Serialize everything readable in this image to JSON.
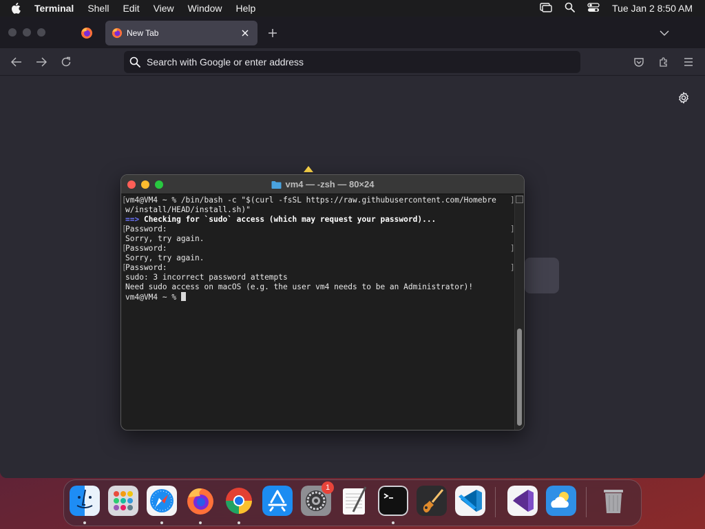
{
  "menubar": {
    "app_name": "Terminal",
    "items": [
      "Shell",
      "Edit",
      "View",
      "Window",
      "Help"
    ],
    "clock": "Tue Jan 2  8:50 AM"
  },
  "browser": {
    "tab_title": "New Tab",
    "url_placeholder": "Search with Google or enter address"
  },
  "terminal": {
    "title": "vm4 — -zsh — 80×24",
    "lines": [
      {
        "text": "vm4@VM4 ~ % /bin/bash -c \"$(curl -fsSL https://raw.githubusercontent.com/Homebre",
        "left_bracket": true,
        "right_bracket": true
      },
      {
        "text": "w/install/HEAD/install.sh)\""
      },
      {
        "prefix": "==>",
        "text": " Checking for `sudo` access (which may request your password)..."
      },
      {
        "text": "Password:",
        "left_bracket": true,
        "right_bracket": true
      },
      {
        "text": "Sorry, try again."
      },
      {
        "text": "Password:",
        "left_bracket": true,
        "right_bracket": true
      },
      {
        "text": "Sorry, try again."
      },
      {
        "text": "Password:",
        "left_bracket": true,
        "right_bracket": true
      },
      {
        "text": "sudo: 3 incorrect password attempts"
      },
      {
        "text": "Need sudo access on macOS (e.g. the user vm4 needs to be an Administrator)!"
      },
      {
        "text": "vm4@VM4 ~ % ",
        "cursor": true
      }
    ],
    "scroll_position": 0.55
  },
  "dock": {
    "apps": [
      {
        "name": "finder",
        "running": true
      },
      {
        "name": "launchpad",
        "running": false
      },
      {
        "name": "safari",
        "running": true
      },
      {
        "name": "firefox",
        "running": true
      },
      {
        "name": "chrome",
        "running": true
      },
      {
        "name": "app-store",
        "running": false
      },
      {
        "name": "system-settings",
        "running": false,
        "badge": "1"
      },
      {
        "name": "textedit",
        "running": false
      },
      {
        "name": "terminal",
        "running": true
      },
      {
        "name": "garageband",
        "running": false
      },
      {
        "name": "vscode",
        "running": false
      },
      {
        "name": "visual-studio",
        "running": false
      },
      {
        "name": "weather",
        "running": false
      },
      {
        "name": "trash",
        "running": false
      }
    ]
  },
  "colors": {
    "terminal_prompt_arrow": "#6b74ff",
    "close": "#ff5f57",
    "minimize": "#febc2e",
    "zoom": "#28c840"
  }
}
